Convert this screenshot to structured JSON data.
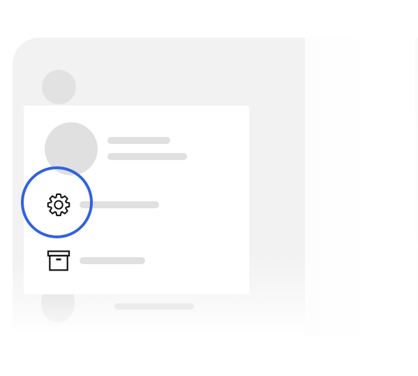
{
  "window": {
    "title": ""
  },
  "menu": {
    "items": [
      {
        "id": "settings",
        "icon": "gear-icon",
        "label": ""
      },
      {
        "id": "archive",
        "icon": "archive-box-icon",
        "label": ""
      }
    ]
  },
  "highlight": {
    "target": "settings",
    "color": "#2f62e0"
  },
  "colors": {
    "panel_background": "#f2f2f2",
    "card_background": "#ffffff",
    "placeholder": "#e0e0e0",
    "icon_stroke": "#111111"
  }
}
